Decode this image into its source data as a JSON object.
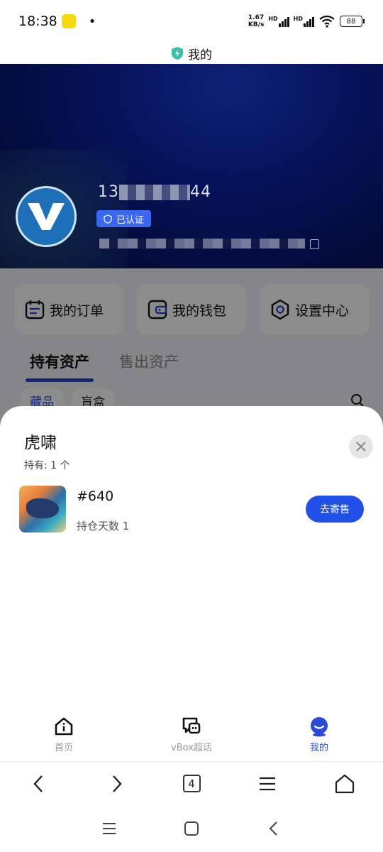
{
  "status_bar": {
    "time": "18:38",
    "net_speed_value": "1.67",
    "net_speed_unit": "KB/s",
    "hd_1": "HD",
    "hd_2": "HD",
    "battery": "88"
  },
  "header": {
    "title": "我的"
  },
  "profile": {
    "phone_prefix": "13",
    "phone_suffix": "44",
    "verified_label": "已认证"
  },
  "quick_menu": [
    {
      "label": "我的订单",
      "icon": "calendar-icon"
    },
    {
      "label": "我的钱包",
      "icon": "wallet-icon"
    },
    {
      "label": "设置中心",
      "icon": "settings-hex-icon"
    }
  ],
  "asset_tabs": {
    "active": "持有资产",
    "inactive": "售出资产"
  },
  "sub_tabs": {
    "collectibles": "藏品",
    "blind_box": "盲盒"
  },
  "sheet": {
    "title": "虎啸",
    "holding_count": "持有: 1 个",
    "item": {
      "id": "#640",
      "days": "持仓天数 1",
      "action": "去寄售"
    }
  },
  "bottom_nav": [
    {
      "label": "首页",
      "icon": "home-icon",
      "active": false
    },
    {
      "label": "vBox超话",
      "icon": "chat-icon",
      "active": false
    },
    {
      "label": "我的",
      "icon": "profile-icon",
      "active": true
    }
  ],
  "browser_toolbar": {
    "tab_count": "4"
  },
  "colors": {
    "accent": "#2150e8",
    "banner": "#0c24a8",
    "verified_badge": "#3a66f0",
    "shield": "#3bbfa8"
  }
}
